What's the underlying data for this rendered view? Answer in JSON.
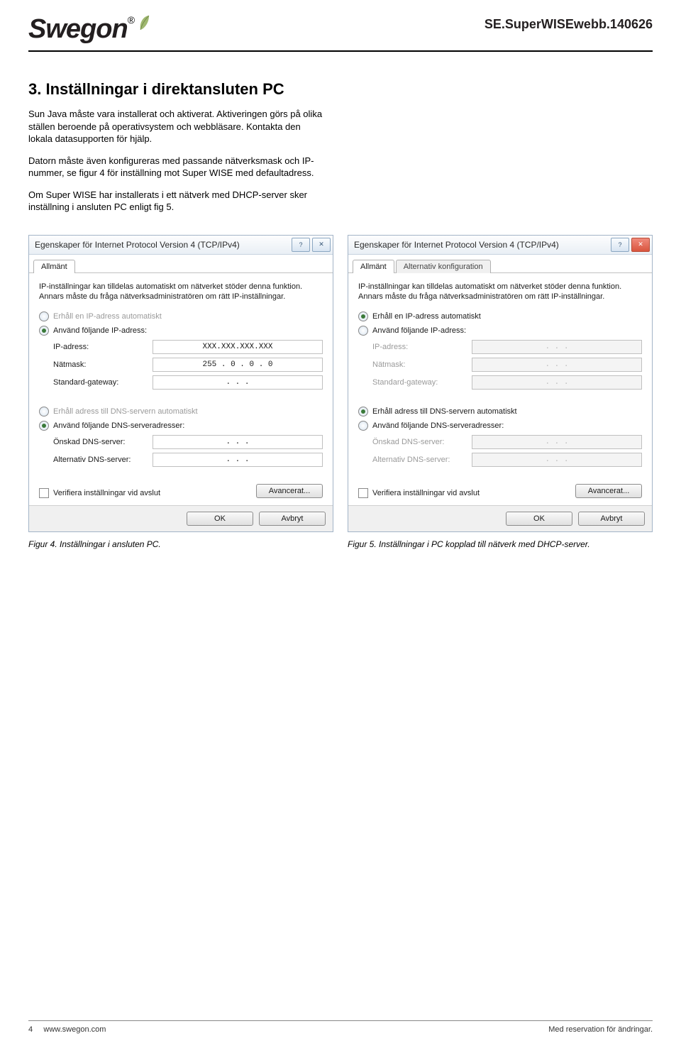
{
  "header": {
    "logo_text": "Swegon",
    "reg": "®",
    "doc_id": "SE.SuperWISEwebb.140626"
  },
  "section": {
    "heading": "3. Inställningar i direktansluten PC",
    "para1": "Sun Java måste vara installerat och aktiverat. Aktiveringen görs på olika ställen beroende på operativsystem och webbläsare. Kontakta den lokala datasupporten för hjälp.",
    "para2": "Datorn måste även konfigureras med passande nätverksmask och IP-nummer, se figur 4 för inställning mot Super WISE med defaultadress.",
    "para3": "Om Super WISE har installerats i ett nätverk med DHCP-server sker inställning i ansluten PC enligt fig 5."
  },
  "common": {
    "dialog_title": "Egenskaper för Internet Protocol Version 4 (TCP/IPv4)",
    "help_btn": "?",
    "close_btn": "✕",
    "tab_general": "Allmänt",
    "tab_alt": "Alternativ konfiguration",
    "help_text": "IP-inställningar kan tilldelas automatiskt om nätverket stöder denna funktion. Annars måste du fråga nätverksadministratören om rätt IP-inställningar.",
    "r_auto_ip": "Erhåll en IP-adress automatiskt",
    "r_manual_ip": "Använd följande IP-adress:",
    "f_ip": "IP-adress:",
    "f_mask": "Nätmask:",
    "f_gateway": "Standard-gateway:",
    "r_auto_dns": "Erhåll adress till DNS-servern automatiskt",
    "r_manual_dns": "Använd följande DNS-serveradresser:",
    "f_dns1": "Önskad DNS-server:",
    "f_dns2": "Alternativ DNS-server:",
    "chk_verify": "Verifiera inställningar vid avslut",
    "btn_adv": "Avancerat...",
    "btn_ok": "OK",
    "btn_cancel": "Avbryt"
  },
  "fig4": {
    "ip_value": "XXX.XXX.XXX.XXX",
    "mask_value": "255 .  0  .  0  .  0",
    "gateway_value": ".        .        .",
    "dns1_value": ".        .        .",
    "dns2_value": ".        .        .",
    "caption": "Figur 4. Inställningar i ansluten PC."
  },
  "fig5": {
    "empty_value": ".        .        .",
    "caption": "Figur 5. Inställningar i PC kopplad till nätverk med DHCP-server."
  },
  "footer": {
    "page_no": "4",
    "url": "www.swegon.com",
    "rights": "Med reservation för ändringar."
  }
}
